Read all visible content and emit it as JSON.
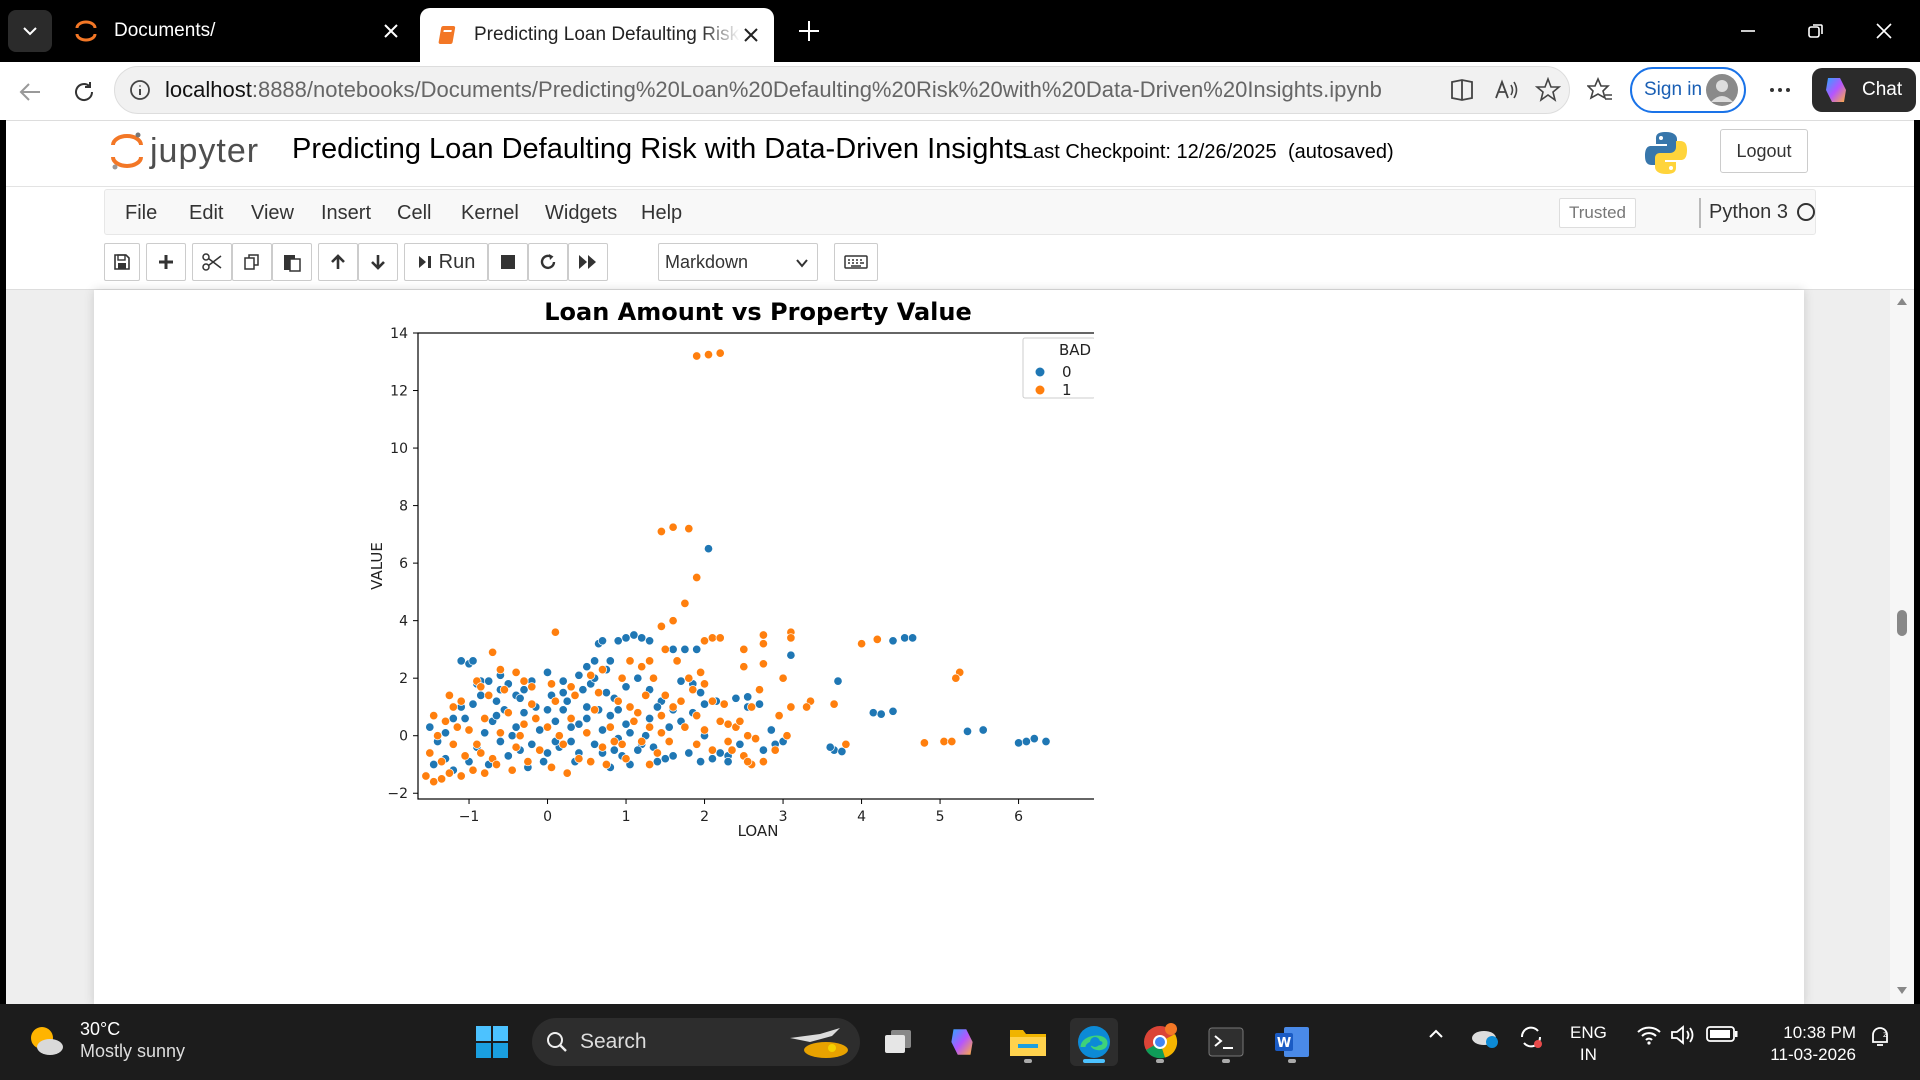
{
  "browser": {
    "tabs": [
      {
        "title": "Documents/",
        "active": false
      },
      {
        "title": "Predicting Loan Defaulting Risk wi",
        "active": true
      }
    ],
    "url_host": "localhost",
    "url_path": ":8888/notebooks/Documents/Predicting%20Loan%20Defaulting%20Risk%20with%20Data-Driven%20Insights.ipynb",
    "sign_in_label": "Sign in",
    "chat_label": "Chat"
  },
  "jupyter": {
    "logo_text": "jupyter",
    "notebook_title": "Predicting Loan Defaulting Risk with Data-Driven Insights",
    "checkpoint": "Last Checkpoint: 12/26/2025",
    "autosaved": "(autosaved)",
    "logout_label": "Logout",
    "menu": [
      "File",
      "Edit",
      "View",
      "Insert",
      "Cell",
      "Kernel",
      "Widgets",
      "Help"
    ],
    "trusted_label": "Trusted",
    "kernel_name": "Python 3",
    "toolbar": {
      "run_label": "Run",
      "cell_type": "Markdown"
    }
  },
  "chart_data": {
    "type": "scatter",
    "title": "Loan Amount vs Property Value",
    "xlabel": "LOAN",
    "ylabel": "VALUE",
    "xlim": [
      -1.65,
      7.05
    ],
    "ylim": [
      -2.2,
      14.0
    ],
    "xticks": [
      -1,
      0,
      1,
      2,
      3,
      4,
      5,
      6
    ],
    "yticks": [
      -2,
      0,
      2,
      4,
      6,
      8,
      10,
      12,
      14
    ],
    "xtick_labels": [
      "−1",
      "0",
      "1",
      "2",
      "3",
      "4",
      "5",
      "6"
    ],
    "ytick_labels": [
      "−2",
      "0",
      "2",
      "4",
      "6",
      "8",
      "10",
      "12",
      "14"
    ],
    "legend": {
      "title": "BAD",
      "position": "top-right",
      "entries": [
        "0",
        "1"
      ]
    },
    "colors": {
      "0": "#1f77b4",
      "1": "#ff7f0e"
    },
    "series": [
      {
        "name": "0",
        "points": [
          [
            -1.1,
            2.6
          ],
          [
            -1.0,
            2.5
          ],
          [
            -0.95,
            2.6
          ],
          [
            -0.9,
            1.8
          ],
          [
            -0.85,
            1.9
          ],
          [
            -0.75,
            1.9
          ],
          [
            -0.6,
            2.1
          ],
          [
            -0.5,
            1.8
          ],
          [
            -0.4,
            1.4
          ],
          [
            -0.3,
            1.6
          ],
          [
            -0.2,
            1.9
          ],
          [
            0.0,
            2.2
          ],
          [
            0.2,
            1.9
          ],
          [
            0.4,
            2.1
          ],
          [
            0.5,
            2.4
          ],
          [
            0.6,
            2.6
          ],
          [
            0.65,
            3.2
          ],
          [
            0.7,
            3.3
          ],
          [
            0.9,
            3.3
          ],
          [
            1.0,
            3.4
          ],
          [
            1.1,
            3.5
          ],
          [
            1.2,
            3.4
          ],
          [
            1.3,
            3.3
          ],
          [
            1.6,
            3.0
          ],
          [
            1.75,
            3.0
          ],
          [
            1.9,
            3.0
          ],
          [
            2.05,
            6.5
          ],
          [
            1.7,
            1.9
          ],
          [
            1.85,
            1.8
          ],
          [
            1.95,
            1.5
          ],
          [
            2.0,
            1.1
          ],
          [
            2.15,
            1.2
          ],
          [
            2.4,
            1.3
          ],
          [
            2.55,
            1.0
          ],
          [
            2.7,
            1.1
          ],
          [
            2.85,
            0.2
          ],
          [
            2.9,
            -0.3
          ],
          [
            3.0,
            -0.2
          ],
          [
            2.75,
            -0.5
          ],
          [
            3.1,
            2.8
          ],
          [
            3.7,
            1.9
          ],
          [
            3.65,
            -0.5
          ],
          [
            3.75,
            -0.55
          ],
          [
            3.6,
            -0.4
          ],
          [
            4.15,
            0.8
          ],
          [
            4.25,
            0.75
          ],
          [
            4.4,
            0.85
          ],
          [
            4.4,
            3.3
          ],
          [
            4.55,
            3.4
          ],
          [
            4.65,
            3.4
          ],
          [
            5.35,
            0.15
          ],
          [
            5.55,
            0.2
          ],
          [
            6.0,
            -0.25
          ],
          [
            6.1,
            -0.2
          ],
          [
            6.2,
            -0.1
          ],
          [
            6.35,
            -0.2
          ],
          [
            1.6,
            -0.7
          ],
          [
            1.8,
            -0.6
          ],
          [
            1.95,
            -0.9
          ],
          [
            2.1,
            -0.8
          ],
          [
            2.2,
            -0.6
          ],
          [
            2.3,
            -0.7
          ],
          [
            1.5,
            -0.8
          ],
          [
            1.4,
            -0.9
          ],
          [
            1.2,
            -0.3
          ],
          [
            1.05,
            0.1
          ],
          [
            1.3,
            0.6
          ],
          [
            1.55,
            0.3
          ],
          [
            1.6,
            0.9
          ],
          [
            1.45,
            1.2
          ],
          [
            1.3,
            1.6
          ],
          [
            1.15,
            2.0
          ],
          [
            1.0,
            1.7
          ],
          [
            0.85,
            1.3
          ],
          [
            -1.5,
            0.3
          ],
          [
            -1.4,
            -0.2
          ],
          [
            -1.3,
            -0.8
          ],
          [
            -1.45,
            -1.0
          ],
          [
            -1.2,
            -1.2
          ],
          [
            -1.0,
            -0.9
          ],
          [
            -0.9,
            -0.4
          ],
          [
            -0.8,
            0.1
          ],
          [
            -0.7,
            0.5
          ],
          [
            -0.6,
            -0.2
          ],
          [
            -0.5,
            -0.7
          ],
          [
            -0.4,
            0.3
          ],
          [
            -0.3,
            0.8
          ],
          [
            -0.2,
            -0.3
          ],
          [
            -0.1,
            0.2
          ],
          [
            0.0,
            -0.6
          ],
          [
            0.1,
            0.5
          ],
          [
            0.2,
            0.9
          ],
          [
            0.3,
            -0.2
          ],
          [
            0.4,
            0.4
          ],
          [
            0.5,
            1.0
          ],
          [
            0.6,
            -0.3
          ],
          [
            0.7,
            0.2
          ],
          [
            0.8,
            0.7
          ],
          [
            0.9,
            -0.1
          ],
          [
            1.0,
            0.4
          ],
          [
            -1.05,
            0.6
          ],
          [
            -0.95,
            1.1
          ],
          [
            -0.85,
            1.4
          ],
          [
            -0.65,
            1.2
          ],
          [
            -0.55,
            0.9
          ],
          [
            -0.35,
            1.3
          ],
          [
            -0.15,
            1.0
          ],
          [
            0.05,
            1.4
          ],
          [
            0.25,
            1.2
          ],
          [
            0.45,
            1.6
          ],
          [
            0.55,
            1.8
          ],
          [
            0.75,
            1.5
          ],
          [
            0.95,
            -0.7
          ],
          [
            0.35,
            -0.9
          ],
          [
            -0.25,
            -1.1
          ],
          [
            -0.75,
            -1.0
          ],
          [
            0.15,
            -0.4
          ],
          [
            0.65,
            0.9
          ],
          [
            -0.45,
            0.0
          ],
          [
            0.85,
            -0.5
          ],
          [
            -1.3,
            0.1
          ],
          [
            -1.2,
            0.6
          ],
          [
            -1.1,
            1.0
          ],
          [
            -0.65,
            0.7
          ],
          [
            0.1,
            -0.2
          ],
          [
            0.3,
            0.3
          ],
          [
            0.5,
            0.6
          ],
          [
            0.7,
            -0.6
          ],
          [
            0.9,
            0.9
          ],
          [
            1.15,
            -0.5
          ],
          [
            1.25,
            0.0
          ],
          [
            1.35,
            -0.4
          ],
          [
            1.05,
            -1.0
          ],
          [
            0.8,
            -1.1
          ],
          [
            0.4,
            -0.6
          ],
          [
            0.0,
            0.9
          ],
          [
            -0.6,
            1.6
          ],
          [
            -0.35,
            -0.5
          ],
          [
            -0.05,
            -0.9
          ],
          [
            0.2,
            1.5
          ],
          [
            0.6,
            2.0
          ],
          [
            0.75,
            2.3
          ],
          [
            0.8,
            2.6
          ],
          [
            1.4,
            1.0
          ],
          [
            2.0,
            0.0
          ],
          [
            1.7,
            0.5
          ],
          [
            2.3,
            -0.9
          ],
          [
            2.45,
            -0.3
          ],
          [
            1.85,
            0.8
          ],
          [
            2.55,
            1.35
          ]
        ]
      },
      {
        "name": "1",
        "points": [
          [
            1.9,
            13.2
          ],
          [
            2.05,
            13.25
          ],
          [
            2.2,
            13.3
          ],
          [
            1.45,
            7.1
          ],
          [
            1.6,
            7.25
          ],
          [
            1.8,
            7.2
          ],
          [
            1.9,
            5.5
          ],
          [
            1.75,
            4.6
          ],
          [
            1.6,
            4.0
          ],
          [
            1.45,
            3.8
          ],
          [
            1.5,
            3.0
          ],
          [
            1.3,
            2.6
          ],
          [
            2.0,
            3.3
          ],
          [
            2.1,
            3.4
          ],
          [
            2.2,
            3.4
          ],
          [
            2.5,
            3.0
          ],
          [
            2.75,
            3.5
          ],
          [
            2.75,
            3.2
          ],
          [
            2.5,
            2.4
          ],
          [
            2.75,
            2.5
          ],
          [
            3.1,
            3.6
          ],
          [
            3.1,
            3.4
          ],
          [
            3.0,
            2.0
          ],
          [
            3.1,
            1.0
          ],
          [
            3.35,
            1.2
          ],
          [
            3.65,
            1.1
          ],
          [
            4.0,
            3.2
          ],
          [
            4.2,
            3.35
          ],
          [
            5.25,
            2.2
          ],
          [
            5.2,
            2.0
          ],
          [
            4.8,
            -0.25
          ],
          [
            5.05,
            -0.2
          ],
          [
            5.15,
            -0.2
          ],
          [
            3.8,
            -0.3
          ],
          [
            2.55,
            0.0
          ],
          [
            2.65,
            -0.1
          ],
          [
            2.3,
            0.4
          ],
          [
            2.4,
            0.3
          ],
          [
            2.2,
            0.5
          ],
          [
            2.0,
            0.2
          ],
          [
            1.9,
            0.7
          ],
          [
            2.1,
            1.2
          ],
          [
            2.25,
            1.1
          ],
          [
            2.7,
            1.6
          ],
          [
            2.6,
            1.0
          ],
          [
            2.45,
            0.5
          ],
          [
            2.95,
            0.7
          ],
          [
            2.35,
            -0.5
          ],
          [
            2.5,
            -0.7
          ],
          [
            2.6,
            -1.0
          ],
          [
            0.1,
            3.6
          ],
          [
            -0.7,
            2.9
          ],
          [
            -0.9,
            1.9
          ],
          [
            -0.85,
            1.7
          ],
          [
            -0.6,
            2.3
          ],
          [
            -0.4,
            2.2
          ],
          [
            -0.3,
            1.9
          ],
          [
            -0.2,
            1.7
          ],
          [
            0.05,
            1.8
          ],
          [
            0.3,
            1.7
          ],
          [
            0.55,
            2.1
          ],
          [
            0.7,
            2.3
          ],
          [
            0.95,
            2.0
          ],
          [
            1.05,
            2.6
          ],
          [
            1.2,
            2.4
          ],
          [
            1.35,
            2.0
          ],
          [
            1.5,
            1.4
          ],
          [
            1.7,
            1.2
          ],
          [
            1.85,
            1.6
          ],
          [
            2.0,
            1.8
          ],
          [
            1.8,
            2.0
          ],
          [
            1.65,
            2.6
          ],
          [
            1.95,
            2.2
          ],
          [
            -1.55,
            -1.4
          ],
          [
            -1.45,
            -1.6
          ],
          [
            -1.35,
            -1.5
          ],
          [
            -1.25,
            -1.3
          ],
          [
            -1.1,
            -1.4
          ],
          [
            -0.95,
            -1.2
          ],
          [
            -0.8,
            -1.3
          ],
          [
            -1.5,
            -0.6
          ],
          [
            -1.4,
            0.0
          ],
          [
            -1.3,
            0.5
          ],
          [
            -1.2,
            1.0
          ],
          [
            -1.1,
            1.2
          ],
          [
            -1.0,
            0.2
          ],
          [
            -0.9,
            -0.3
          ],
          [
            -0.8,
            0.6
          ],
          [
            -0.7,
            -0.8
          ],
          [
            -0.6,
            0.1
          ],
          [
            -0.5,
            0.8
          ],
          [
            -0.4,
            -0.4
          ],
          [
            -0.3,
            0.4
          ],
          [
            -0.2,
            1.1
          ],
          [
            -0.1,
            -0.5
          ],
          [
            0.0,
            0.3
          ],
          [
            0.1,
            1.2
          ],
          [
            0.2,
            -0.3
          ],
          [
            0.3,
            0.6
          ],
          [
            0.4,
            -0.8
          ],
          [
            0.5,
            0.1
          ],
          [
            0.6,
            0.9
          ],
          [
            0.7,
            -0.4
          ],
          [
            0.8,
            0.3
          ],
          [
            0.9,
            1.2
          ],
          [
            1.0,
            -0.8
          ],
          [
            1.1,
            0.5
          ],
          [
            1.2,
            -0.2
          ],
          [
            1.3,
            0.3
          ],
          [
            1.4,
            -0.6
          ],
          [
            -1.35,
            -0.9
          ],
          [
            -1.2,
            -0.3
          ],
          [
            -1.05,
            -0.7
          ],
          [
            -0.85,
            -0.6
          ],
          [
            -0.65,
            -1.0
          ],
          [
            -0.45,
            -1.2
          ],
          [
            -0.25,
            -0.9
          ],
          [
            0.05,
            -1.1
          ],
          [
            0.25,
            -1.3
          ],
          [
            0.55,
            -0.9
          ],
          [
            0.75,
            -1.0
          ],
          [
            0.95,
            -0.3
          ],
          [
            1.15,
            0.8
          ],
          [
            1.3,
            -1.0
          ],
          [
            1.45,
            0.1
          ],
          [
            1.55,
            -0.2
          ],
          [
            -1.45,
            0.7
          ],
          [
            -1.25,
            1.4
          ],
          [
            -1.15,
            0.3
          ],
          [
            -0.75,
            1.4
          ],
          [
            -0.55,
            1.6
          ],
          [
            -0.35,
            0.0
          ],
          [
            -0.15,
            0.6
          ],
          [
            0.15,
            0.0
          ],
          [
            0.35,
            1.4
          ],
          [
            0.65,
            1.5
          ],
          [
            0.85,
            -0.2
          ],
          [
            1.05,
            1.0
          ],
          [
            1.25,
            1.4
          ],
          [
            1.45,
            0.7
          ],
          [
            1.6,
            1.0
          ],
          [
            1.75,
            0.3
          ],
          [
            1.9,
            -0.3
          ],
          [
            2.1,
            -0.5
          ],
          [
            2.3,
            -0.2
          ],
          [
            2.55,
            -0.9
          ],
          [
            2.75,
            -0.9
          ],
          [
            2.9,
            -0.5
          ],
          [
            3.05,
            0.0
          ],
          [
            3.3,
            1.0
          ]
        ]
      }
    ]
  },
  "taskbar": {
    "temperature": "30°C",
    "condition": "Mostly sunny",
    "search_label": "Search",
    "lang_top": "ENG",
    "lang_bottom": "IN",
    "time": "10:38 PM",
    "date": "11-03-2026"
  }
}
